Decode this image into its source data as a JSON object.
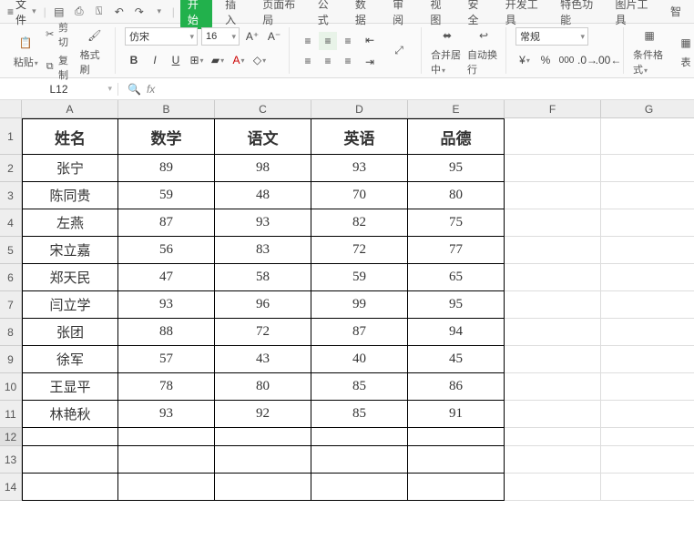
{
  "menu": {
    "file": "文件",
    "tabs": [
      "开始",
      "插入",
      "页面布局",
      "公式",
      "数据",
      "审阅",
      "视图",
      "安全",
      "开发工具",
      "特色功能",
      "图片工具",
      "智"
    ]
  },
  "clipboard": {
    "paste": "粘贴",
    "cut": "剪切",
    "copy": "复制",
    "format_painter": "格式刷"
  },
  "font": {
    "name": "仿宋",
    "size": "16"
  },
  "align": {
    "merge_center": "合并居中",
    "wrap": "自动换行"
  },
  "number": {
    "format": "常规"
  },
  "cond_format": "条件格式",
  "table_style": "表",
  "namebox": "L12",
  "chart_data": {
    "type": "table",
    "columns": [
      "姓名",
      "数学",
      "语文",
      "英语",
      "品德"
    ],
    "rows": [
      [
        "张宁",
        89,
        98,
        93,
        95
      ],
      [
        "陈同贵",
        59,
        48,
        70,
        80
      ],
      [
        "左燕",
        87,
        93,
        82,
        75
      ],
      [
        "宋立嘉",
        56,
        83,
        72,
        77
      ],
      [
        "郑天民",
        47,
        58,
        59,
        65
      ],
      [
        "闫立学",
        93,
        96,
        99,
        95
      ],
      [
        "张团",
        88,
        72,
        87,
        94
      ],
      [
        "徐军",
        57,
        43,
        40,
        45
      ],
      [
        "王显平",
        78,
        80,
        85,
        86
      ],
      [
        "林艳秋",
        93,
        92,
        85,
        91
      ]
    ]
  },
  "col_labels": [
    "A",
    "B",
    "C",
    "D",
    "E",
    "F",
    "G"
  ]
}
